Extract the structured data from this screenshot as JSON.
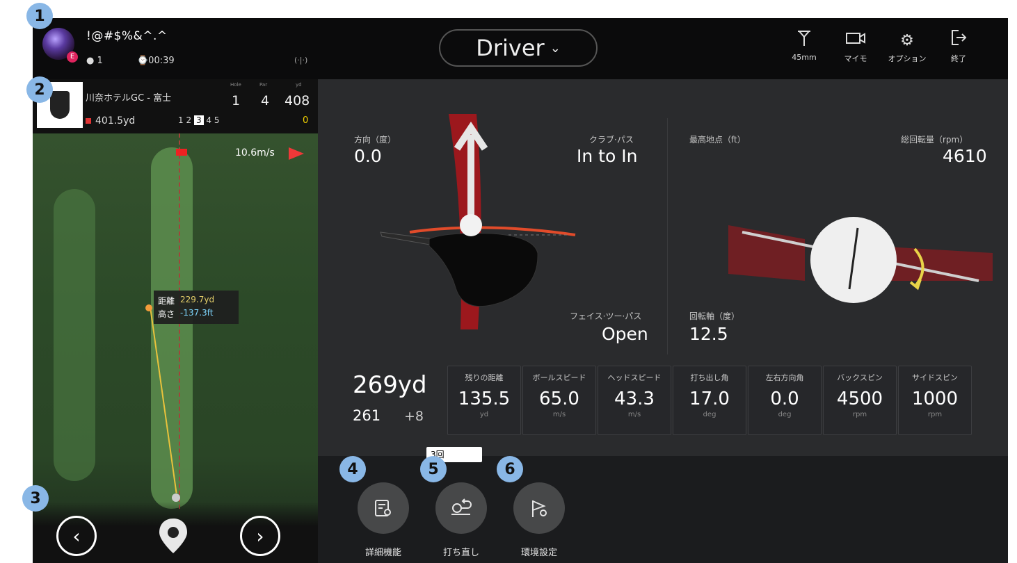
{
  "player": {
    "name": "!@#$%&^.^",
    "level_badge": "E",
    "shots": "● 1",
    "timer": "⌚00:39",
    "signal": "(·|·)"
  },
  "header": {
    "club": "Driver",
    "tools": [
      {
        "icon": "tee-icon",
        "label": "45mm"
      },
      {
        "icon": "camera-icon",
        "label": "マイモ"
      },
      {
        "icon": "gear-icon",
        "label": "オプション"
      },
      {
        "icon": "exit-icon",
        "label": "終了"
      }
    ]
  },
  "hole": {
    "course": "川奈ホテルGC - 富士",
    "hdr_hole": "Hole",
    "hdr_par": "Par",
    "hdr_yd": "yd",
    "number": "1",
    "par": "4",
    "yards": "408",
    "remaining": "401.5yd",
    "shots": [
      "1",
      "2",
      "3",
      "4",
      "5"
    ],
    "selected_shot": "3",
    "score": "0"
  },
  "map": {
    "wind": "10.6m/s",
    "dist_label": "距離",
    "dist_value": "229.7yd",
    "height_label": "高さ",
    "height_value": "-137.3ft"
  },
  "shot": {
    "direction_label": "方向（度）",
    "direction_value": "0.0",
    "clubpath_label": "クラブ·パス",
    "clubpath_value": "In to In",
    "faceangle_label": "フェイス·ツー·パス",
    "faceangle_value": "Open",
    "apex_label": "最高地点（ft）",
    "totalspin_label": "総回転量（rpm）",
    "totalspin_value": "4610",
    "spinaxis_label": "回転軸（度）",
    "spinaxis_value": "12.5",
    "total": "269yd",
    "carry": "261",
    "roll": "+8"
  },
  "metrics": [
    {
      "title": "残りの距離",
      "value": "135.5",
      "unit": "yd"
    },
    {
      "title": "ボールスピード",
      "value": "65.0",
      "unit": "m/s"
    },
    {
      "title": "ヘッドスピード",
      "value": "43.3",
      "unit": "m/s"
    },
    {
      "title": "打ち出し角",
      "value": "17.0",
      "unit": "deg"
    },
    {
      "title": "左右方向角",
      "value": "0.0",
      "unit": "deg"
    },
    {
      "title": "バックスピン",
      "value": "4500",
      "unit": "rpm"
    },
    {
      "title": "サイドスピン",
      "value": "1000",
      "unit": "rpm"
    }
  ],
  "actions": [
    {
      "label": "詳細機能",
      "icon": "details-icon"
    },
    {
      "label": "打ち直し",
      "icon": "retry-icon"
    },
    {
      "label": "環境設定",
      "icon": "settings-flag-icon"
    }
  ],
  "retry_count": "3回",
  "markers": [
    "1",
    "2",
    "3",
    "4",
    "5",
    "6"
  ],
  "colors": {
    "marker": "#89b7e6",
    "wind_arrow": "#ef3838",
    "accent_red": "#c4232a",
    "score_yellow": "#f3d200"
  }
}
